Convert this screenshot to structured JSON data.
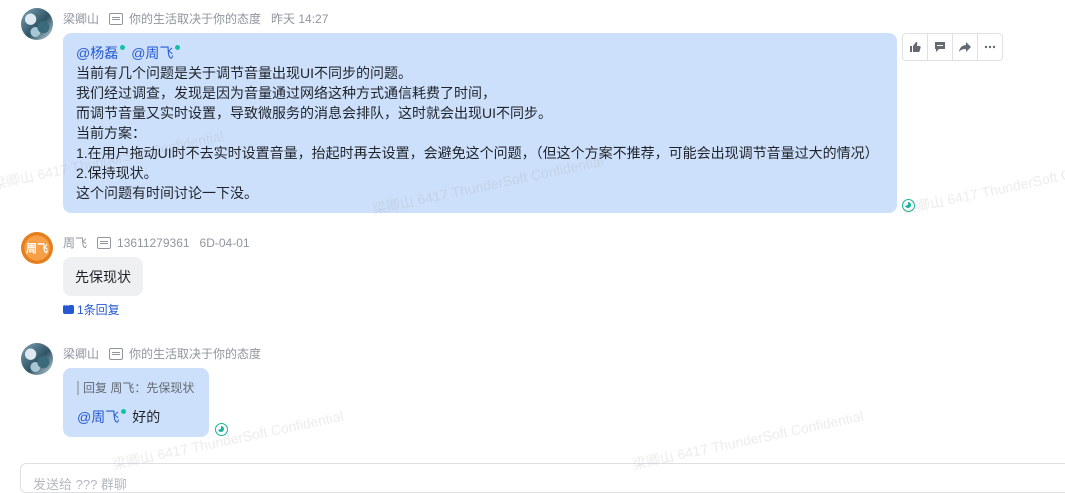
{
  "messages": [
    {
      "sender": "梁卿山",
      "signature": "你的生活取决于你的态度",
      "time": "昨天 14:27",
      "mentions": [
        "@杨磊",
        "@周飞"
      ],
      "lines": [
        "当前有几个问题是关于调节音量出现UI不同步的问题。",
        "我们经过调查，发现是因为音量通过网络这种方式通信耗费了时间，",
        "而调节音量又实时设置，导致微服务的消息会排队，这时就会出现UI不同步。",
        "当前方案：",
        "1.在用户拖动UI时不去实时设置音量，抬起时再去设置，会避免这个问题，（但这个方案不推荐，可能会出现调节音量过大的情况）",
        "2.保持现状。",
        "这个问题有时间讨论一下没。"
      ]
    },
    {
      "sender": "周飞",
      "avatar_text": "周飞",
      "signature": "13611279361",
      "time": "6D-04-01",
      "text": "先保现状",
      "reply_count": "1条回复"
    },
    {
      "sender": "梁卿山",
      "signature": "你的生活取决于你的态度",
      "quote": "回复 周飞：先保现状",
      "mention": "@周飞",
      "text": "好的"
    }
  ],
  "watermark": "梁卿山 6417 ThunderSoft Confidential",
  "input_placeholder": "发送给 ??? 群聊",
  "colors": {
    "bubble_self": "#cde0fb",
    "bubble_other": "#eff0f1",
    "mention": "#2559d3",
    "online": "#14c0a8"
  },
  "toolbar_icons": [
    "thumbs-up-icon",
    "comment-icon",
    "forward-icon",
    "more-icon"
  ]
}
